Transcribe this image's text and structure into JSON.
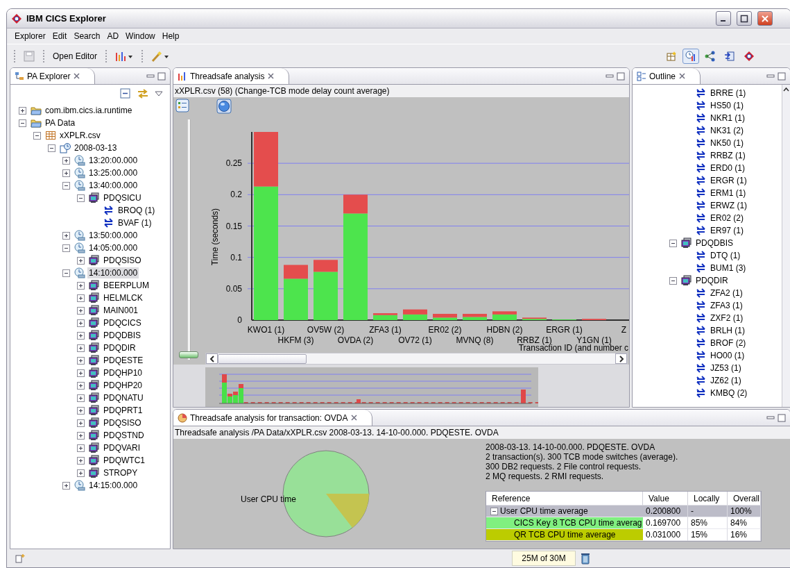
{
  "window": {
    "title": "IBM CICS Explorer"
  },
  "menu": [
    "Explorer",
    "Edit",
    "Search",
    "AD",
    "Window",
    "Help"
  ],
  "toolbar": {
    "open_editor": "Open Editor"
  },
  "perspectives": [
    {
      "kind": "open",
      "selected": false
    },
    {
      "kind": "performance",
      "selected": true
    },
    {
      "kind": "network",
      "selected": false
    },
    {
      "kind": "transfer",
      "selected": false
    },
    {
      "kind": "cics",
      "selected": false
    }
  ],
  "pa_explorer": {
    "tab": "PA Explorer",
    "tree": [
      {
        "kind": "folder",
        "label": "com.ibm.cics.ia.runtime",
        "expanded": false,
        "selected": false
      },
      {
        "kind": "folder",
        "label": "PA Data",
        "expanded": true,
        "selected": false,
        "children": [
          {
            "kind": "csv",
            "label": "xXPLR.csv",
            "expanded": true,
            "selected": false,
            "children": [
              {
                "kind": "date",
                "label": "2008-03-13",
                "expanded": true,
                "selected": false,
                "children": [
                  {
                    "kind": "time",
                    "label": "13:20:00.000",
                    "expanded": false,
                    "selected": false
                  },
                  {
                    "kind": "time",
                    "label": "13:25:00.000",
                    "expanded": false,
                    "selected": false
                  },
                  {
                    "kind": "time",
                    "label": "13:40:00.000",
                    "expanded": true,
                    "selected": false,
                    "children": [
                      {
                        "kind": "region",
                        "label": "PDQSICU",
                        "expanded": true,
                        "selected": false,
                        "children": [
                          {
                            "kind": "transaction",
                            "label": "BROQ (1)",
                            "selected": false
                          },
                          {
                            "kind": "transaction",
                            "label": "BVAF (1)",
                            "selected": false
                          }
                        ]
                      }
                    ]
                  },
                  {
                    "kind": "time",
                    "label": "13:50:00.000",
                    "expanded": false,
                    "selected": false
                  },
                  {
                    "kind": "time",
                    "label": "14:05:00.000",
                    "expanded": true,
                    "selected": false,
                    "children": [
                      {
                        "kind": "region",
                        "label": "PDQSISO",
                        "expanded": false,
                        "selected": false
                      }
                    ]
                  },
                  {
                    "kind": "time",
                    "label": "14:10:00.000",
                    "expanded": true,
                    "selected": true,
                    "children": [
                      {
                        "kind": "region",
                        "label": "BEERPLUM",
                        "expanded": false,
                        "selected": false
                      },
                      {
                        "kind": "region",
                        "label": "HELMLCK",
                        "expanded": false,
                        "selected": false
                      },
                      {
                        "kind": "region",
                        "label": "MAIN001",
                        "expanded": false,
                        "selected": false
                      },
                      {
                        "kind": "region",
                        "label": "PDQCICS",
                        "expanded": false,
                        "selected": false
                      },
                      {
                        "kind": "region",
                        "label": "PDQDBIS",
                        "expanded": false,
                        "selected": false
                      },
                      {
                        "kind": "region",
                        "label": "PDQDIR",
                        "expanded": false,
                        "selected": false
                      },
                      {
                        "kind": "region",
                        "label": "PDQESTE",
                        "expanded": false,
                        "selected": false
                      },
                      {
                        "kind": "region",
                        "label": "PDQHP10",
                        "expanded": false,
                        "selected": false
                      },
                      {
                        "kind": "region",
                        "label": "PDQHP20",
                        "expanded": false,
                        "selected": false
                      },
                      {
                        "kind": "region",
                        "label": "PDQNATU",
                        "expanded": false,
                        "selected": false
                      },
                      {
                        "kind": "region",
                        "label": "PDQPRT1",
                        "expanded": false,
                        "selected": false
                      },
                      {
                        "kind": "region",
                        "label": "PDQSISO",
                        "expanded": false,
                        "selected": false
                      },
                      {
                        "kind": "region",
                        "label": "PDQSTND",
                        "expanded": false,
                        "selected": false
                      },
                      {
                        "kind": "region",
                        "label": "PDQVARI",
                        "expanded": false,
                        "selected": false
                      },
                      {
                        "kind": "region",
                        "label": "PDQWTC1",
                        "expanded": false,
                        "selected": false
                      },
                      {
                        "kind": "region",
                        "label": "STROPY",
                        "expanded": false,
                        "selected": false
                      }
                    ]
                  },
                  {
                    "kind": "time",
                    "label": "14:15:00.000",
                    "expanded": false,
                    "selected": false
                  }
                ]
              }
            ]
          }
        ]
      }
    ]
  },
  "analysis": {
    "tab": "Threadsafe analysis",
    "caption": "xXPLR.csv (58) (Change-TCB mode delay count average)",
    "zoom_slider": {
      "level": 0
    },
    "chart_data": {
      "type": "bar",
      "stacked": true,
      "ylabel": "Time (seconds)",
      "xlabel": "Transaction ID (and number c",
      "categories": [
        "KWO1 (1)",
        "HKFM (3)",
        "OV5W (2)",
        "OVDA (2)",
        "ZFA3 (1)",
        "OV72 (1)",
        "ER02 (2)",
        "MVNQ (8)",
        "HDBN (2)",
        "RRBZ (1)",
        "ERGR (1)",
        "Y1GN (1)",
        "Z"
      ],
      "ylim": [
        0,
        0.3
      ],
      "grid": true,
      "yticks": [
        0,
        0.05,
        0.1,
        0.15,
        0.2,
        0.25
      ],
      "series": [
        {
          "color": "#4de44d",
          "values": [
            0.213,
            0.066,
            0.077,
            0.17,
            0.008,
            0.009,
            0.004,
            0.005,
            0.009,
            0.002,
            0.001,
            0,
            null
          ]
        },
        {
          "color": "#e44d4d",
          "values": [
            0.087,
            0.022,
            0.019,
            0.03,
            0.003,
            0.008,
            0.006,
            0.005,
            0.005,
            0.002,
            0,
            0.002,
            null
          ]
        }
      ]
    }
  },
  "outline": {
    "tab": "Outline",
    "items": [
      {
        "kind": "transaction",
        "label": "BRRE (1)",
        "selected": false
      },
      {
        "kind": "transaction",
        "label": "HS50 (1)",
        "selected": false
      },
      {
        "kind": "transaction",
        "label": "NKR1 (1)",
        "selected": false
      },
      {
        "kind": "transaction",
        "label": "NK31 (2)",
        "selected": false
      },
      {
        "kind": "transaction",
        "label": "NK50 (1)",
        "selected": false
      },
      {
        "kind": "transaction",
        "label": "RRBZ (1)",
        "selected": false
      },
      {
        "kind": "transaction",
        "label": "ERD0 (1)",
        "selected": false
      },
      {
        "kind": "transaction",
        "label": "ERGR (1)",
        "selected": false
      },
      {
        "kind": "transaction",
        "label": "ERM1 (1)",
        "selected": false
      },
      {
        "kind": "transaction",
        "label": "ERWZ (1)",
        "selected": false
      },
      {
        "kind": "transaction",
        "label": "ER02 (2)",
        "selected": false
      },
      {
        "kind": "transaction",
        "label": "ER97 (1)",
        "selected": false
      },
      {
        "kind": "region",
        "label": "PDQDBIS",
        "expanded": true,
        "selected": false,
        "children": [
          {
            "kind": "transaction",
            "label": "DTQ (1)",
            "selected": false
          },
          {
            "kind": "transaction",
            "label": "BUM1 (3)",
            "selected": false
          }
        ]
      },
      {
        "kind": "region",
        "label": "PDQDIR",
        "expanded": true,
        "selected": false,
        "children": [
          {
            "kind": "transaction",
            "label": "ZFA2 (1)",
            "selected": false
          },
          {
            "kind": "transaction",
            "label": "ZFA3 (1)",
            "selected": false
          },
          {
            "kind": "transaction",
            "label": "ZXF2 (1)",
            "selected": false
          },
          {
            "kind": "transaction",
            "label": "BRLH (1)",
            "selected": false
          },
          {
            "kind": "transaction",
            "label": "BROF (2)",
            "selected": false
          },
          {
            "kind": "transaction",
            "label": "HO00 (1)",
            "selected": false
          },
          {
            "kind": "transaction",
            "label": "JZ53 (1)",
            "selected": false
          },
          {
            "kind": "transaction",
            "label": "JZ62 (1)",
            "selected": false
          },
          {
            "kind": "transaction",
            "label": "KMBQ (2)",
            "selected": false
          }
        ]
      }
    ]
  },
  "transaction_view": {
    "tab": "Threadsafe analysis for transaction: OVDA",
    "path": "Threadsafe analysis /PA Data/xXPLR.csv 2008-03-13. 14-10-00.000. PDQESTE. OVDA",
    "pie_label": "User CPU time",
    "summary": [
      "2008-03-13. 14-10-00.000. PDQESTE. OVDA",
      "2 transaction(s). 300 TCB mode switches (average).",
      "300 DB2 requests. 2 File control requests.",
      "2 MQ requests. 2 RMI requests."
    ],
    "table": {
      "columns": [
        "Reference",
        "Value",
        "Locally",
        "Overall"
      ],
      "rows": [
        {
          "reference": "User CPU time average",
          "value": "0.200800",
          "locally": "-",
          "overall": "100%",
          "expanded": true,
          "color": "#bcbcc8",
          "children": [
            {
              "reference": "CICS Key 8 TCB CPU time averag",
              "value": "0.169700",
              "locally": "85%",
              "overall": "84%",
              "color": "#80f080"
            },
            {
              "reference": "QR TCB CPU time average",
              "value": "0.031000",
              "locally": "15%",
              "overall": "16%",
              "color": "#bccc00"
            }
          ]
        }
      ]
    }
  },
  "status_bar": {
    "memory": "25M of 30M"
  }
}
